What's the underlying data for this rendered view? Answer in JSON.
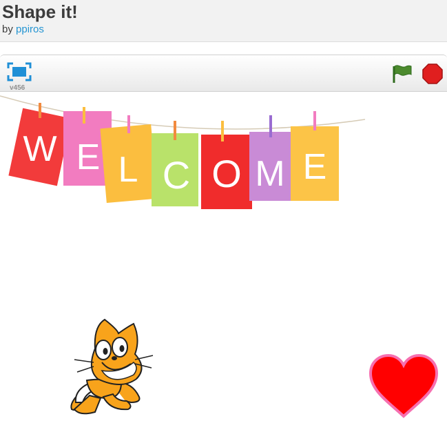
{
  "project": {
    "title": "Shape it!",
    "by_label": "by",
    "author": "ppiros"
  },
  "player": {
    "version": "v456",
    "icons": {
      "fullscreen": "fullscreen-icon",
      "flag": "green-flag-icon",
      "stop": "stop-icon"
    }
  },
  "stage": {
    "banner_letters": [
      "W",
      "E",
      "L",
      "C",
      "O",
      "M",
      "E"
    ],
    "banner_colors": [
      "#f23b3b",
      "#f27cc0",
      "#fbbe3f",
      "#b9e26a",
      "#f02c2c",
      "#c98bd6",
      "#fcc447"
    ],
    "sprites": [
      "cat",
      "heart"
    ]
  },
  "colors": {
    "link": "#2595d2",
    "heart": "#ff0000",
    "heart_outline": "#f66fb0",
    "cat_orange": "#f8a31b",
    "flag_green": "#4c8a2e",
    "stop_red": "#e01f1f"
  }
}
